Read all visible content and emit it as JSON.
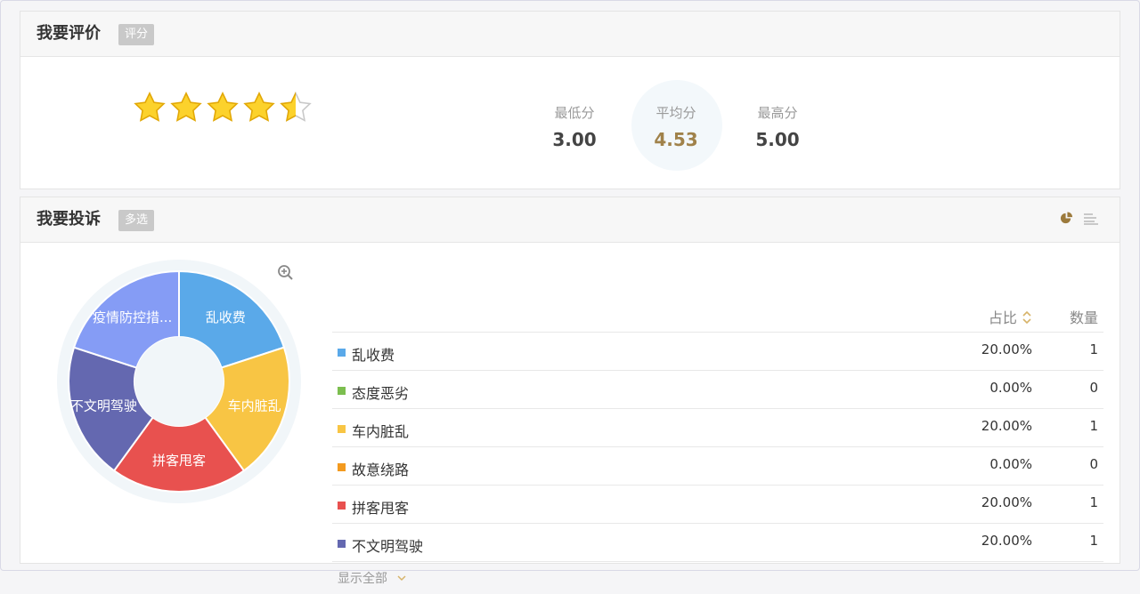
{
  "rating": {
    "title": "我要评价",
    "tag": "评分",
    "stars_value": 4.5,
    "min": {
      "label": "最低分",
      "value": "3.00"
    },
    "avg": {
      "label": "平均分",
      "value": "4.53"
    },
    "max": {
      "label": "最高分",
      "value": "5.00"
    }
  },
  "complaint": {
    "title": "我要投诉",
    "tag": "多选",
    "icons": [
      "pie-chart-icon",
      "bar-list-icon",
      "zoom-in-icon",
      "sort-icon",
      "chevron-down-icon"
    ],
    "table": {
      "col_pct": "占比",
      "col_count": "数量",
      "rows": [
        {
          "name": "乱收费",
          "pct": "20.00%",
          "count": "1",
          "color": "#5aa9e9"
        },
        {
          "name": "态度恶劣",
          "pct": "0.00%",
          "count": "0",
          "color": "#7cbe4f"
        },
        {
          "name": "车内脏乱",
          "pct": "20.00%",
          "count": "1",
          "color": "#f8c544"
        },
        {
          "name": "故意绕路",
          "pct": "0.00%",
          "count": "0",
          "color": "#f39a1f"
        },
        {
          "name": "拼客甩客",
          "pct": "20.00%",
          "count": "1",
          "color": "#e8514f"
        },
        {
          "name": "不文明驾驶",
          "pct": "20.00%",
          "count": "1",
          "color": "#6468b0"
        }
      ]
    },
    "show_all": "显示全部",
    "pie_labels": [
      "乱收费",
      "车内脏乱",
      "拼客甩客",
      "不文明驾驶",
      "疫情防控措..."
    ],
    "pie_colors": [
      "#5aa9e9",
      "#f8c544",
      "#e8514f",
      "#6468b0",
      "#859cf5"
    ]
  },
  "chart_data": {
    "type": "pie",
    "categories": [
      "乱收费",
      "车内脏乱",
      "拼客甩客",
      "不文明驾驶",
      "疫情防控措..."
    ],
    "values": [
      20,
      20,
      20,
      20,
      20
    ]
  }
}
